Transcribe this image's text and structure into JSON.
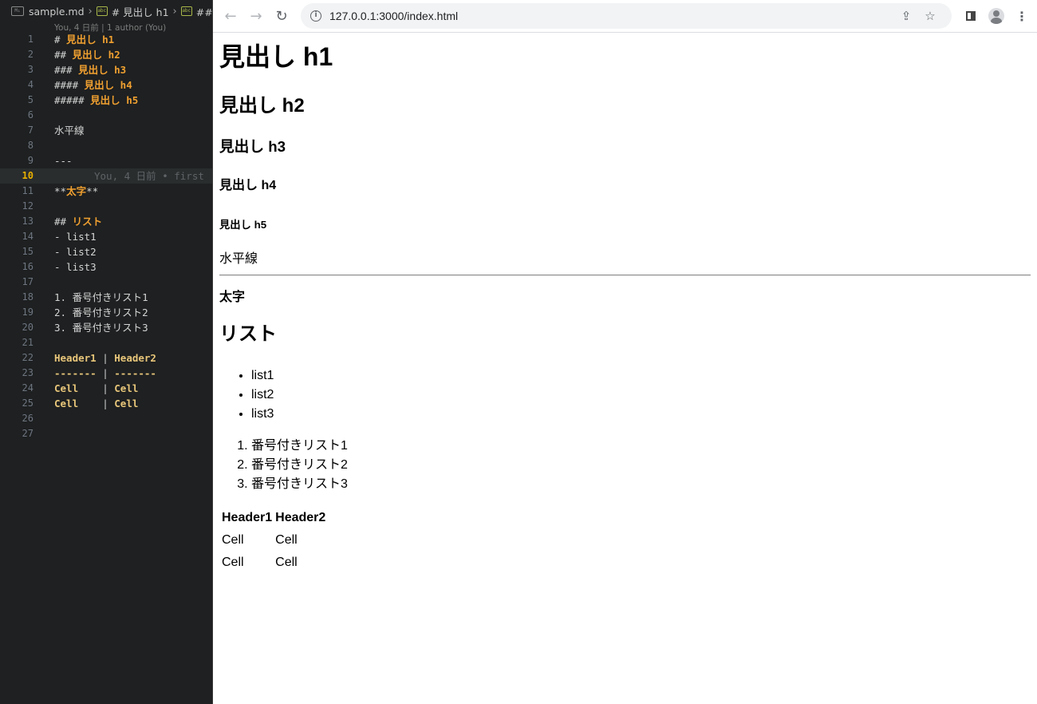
{
  "editor": {
    "breadcrumb": {
      "file": "sample.md",
      "h1": "# 見出し h1",
      "h2": "## 見"
    },
    "codelens": "You, 4 日前 | 1 author (You)",
    "ghost_blame": "You, 4 日前 • first",
    "lines": {
      "l1": {
        "hash": "#",
        "text": "見出し h1"
      },
      "l2": {
        "hash": "##",
        "text": "見出し h2"
      },
      "l3": {
        "hash": "###",
        "text": "見出し h3"
      },
      "l4": {
        "hash": "####",
        "text": "見出し h4"
      },
      "l5": {
        "hash": "#####",
        "text": "見出し h5"
      },
      "l7": "水平線",
      "l9": "---",
      "l11": {
        "open": "**",
        "text": "太字",
        "close": "**"
      },
      "l13": {
        "hash": "##",
        "text": "リスト"
      },
      "l14": "- list1",
      "l15": "- list2",
      "l16": "- list3",
      "l18": {
        "num": "1.",
        "text": "番号付きリスト1"
      },
      "l19": {
        "num": "2.",
        "text": "番号付きリスト2"
      },
      "l20": {
        "num": "3.",
        "text": "番号付きリスト3"
      },
      "l22": {
        "a": "Header1",
        "b": "Header2"
      },
      "l23": {
        "a": "-------",
        "b": "-------"
      },
      "l24": {
        "a": "Cell   ",
        "b": "Cell"
      },
      "l25": {
        "a": "Cell   ",
        "b": "Cell"
      }
    },
    "line_numbers": [
      "1",
      "2",
      "3",
      "4",
      "5",
      "6",
      "7",
      "8",
      "9",
      "10",
      "11",
      "12",
      "13",
      "14",
      "15",
      "16",
      "17",
      "18",
      "19",
      "20",
      "21",
      "22",
      "23",
      "24",
      "25",
      "26",
      "27"
    ]
  },
  "browser": {
    "url": "127.0.0.1:3000/index.html",
    "icons": [
      "back-arrow-icon",
      "forward-arrow-icon",
      "reload-icon",
      "info-icon",
      "share-icon",
      "star-icon",
      "side-panel-icon",
      "profile-icon",
      "kebab-menu-icon"
    ]
  },
  "page": {
    "h1": "見出し h1",
    "h2": "見出し h2",
    "h3": "見出し h3",
    "h4": "見出し h4",
    "h5": "見出し h5",
    "horizontal_text": "水平線",
    "bold_text": "太字",
    "list_heading": "リスト",
    "ul": [
      "list1",
      "list2",
      "list3"
    ],
    "ol": [
      "番号付きリスト1",
      "番号付きリスト2",
      "番号付きリスト3"
    ],
    "table": {
      "headers": [
        "Header1",
        "Header2"
      ],
      "rows": [
        [
          "Cell",
          "Cell"
        ],
        [
          "Cell",
          "Cell"
        ]
      ]
    }
  }
}
